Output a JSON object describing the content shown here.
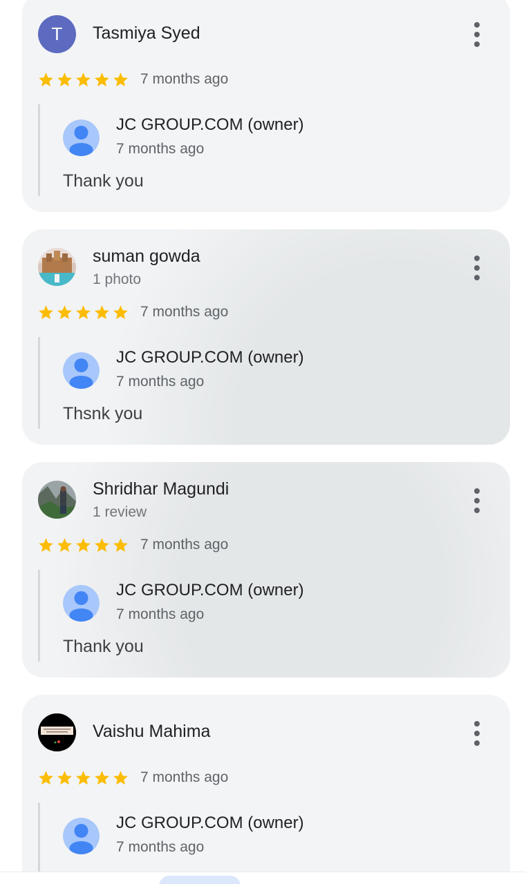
{
  "reviews": [
    {
      "reviewer_name": "Tasmiya Syed",
      "avatar_letter": "T",
      "subtitle": "",
      "rating": 5,
      "date": "7 months ago",
      "reply": {
        "owner_name": "JC GROUP.COM (owner)",
        "date": "7 months ago",
        "text": "Thank you"
      }
    },
    {
      "reviewer_name": "suman gowda",
      "subtitle": "1 photo",
      "rating": 5,
      "date": "7 months ago",
      "reply": {
        "owner_name": "JC GROUP.COM (owner)",
        "date": "7 months ago",
        "text": "Thsnk you"
      }
    },
    {
      "reviewer_name": "Shridhar Magundi",
      "subtitle": "1 review",
      "rating": 5,
      "date": "7 months ago",
      "reply": {
        "owner_name": "JC GROUP.COM (owner)",
        "date": "7 months ago",
        "text": "Thank you"
      }
    },
    {
      "reviewer_name": "Vaishu Mahima",
      "subtitle": "",
      "rating": 5,
      "date": "7 months ago",
      "reply": {
        "owner_name": "JC GROUP.COM (owner)",
        "date": "7 months ago"
      }
    }
  ],
  "colors": {
    "star": "#fbbc04",
    "card_background": "#f3f4f6",
    "letter_avatar": "#5c6bc0",
    "owner_avatar_light": "#a8c7fa",
    "owner_avatar_dark": "#4285f4"
  },
  "icons": {
    "more": "more-vert-icon",
    "star": "star-icon",
    "owner_avatar": "person-icon"
  }
}
